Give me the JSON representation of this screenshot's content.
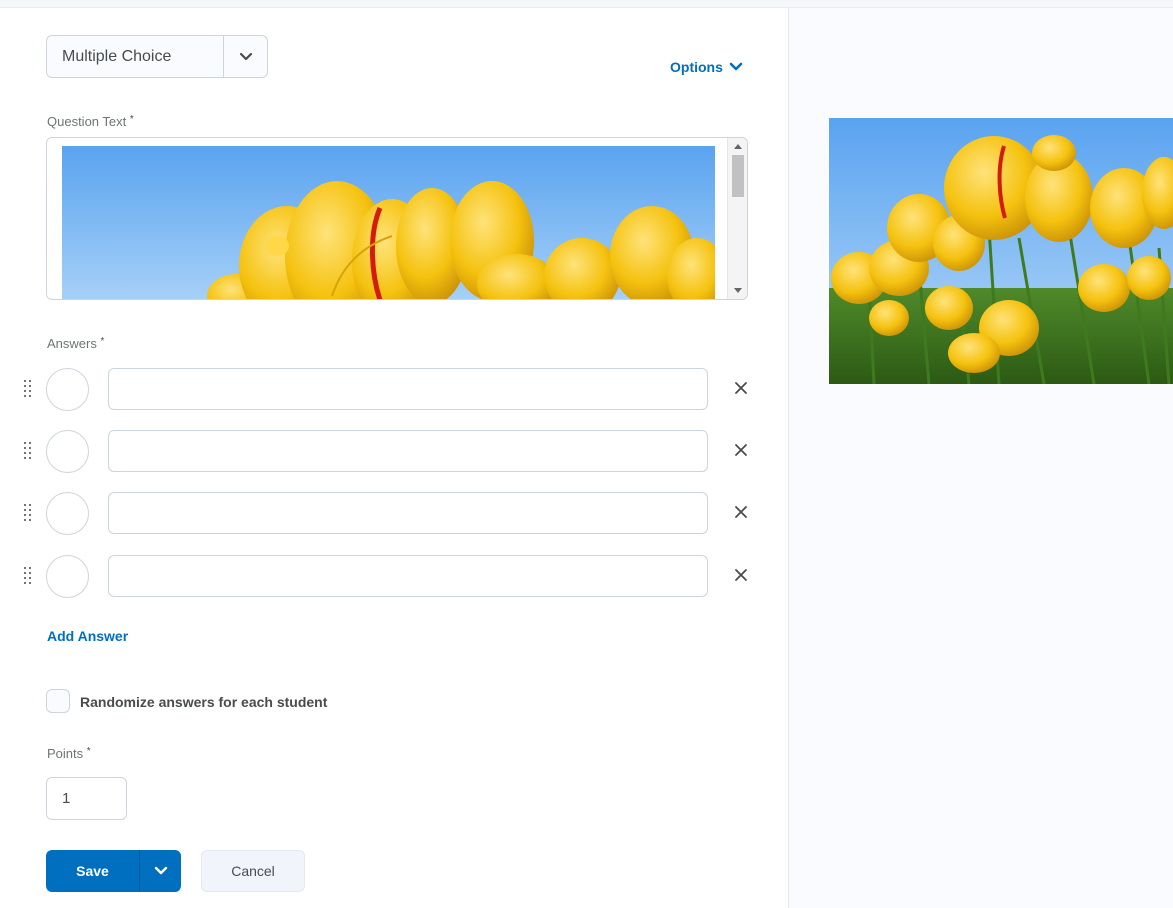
{
  "question_type": {
    "selected": "Multiple Choice",
    "icon": "chevron-down-icon"
  },
  "options_link": {
    "label": "Options",
    "icon": "chevron-down-icon"
  },
  "question_text": {
    "label": "Question Text",
    "required_marker": "*",
    "image": "yellow-tulips-image"
  },
  "answers": {
    "label": "Answers",
    "required_marker": "*",
    "items": [
      {
        "value": ""
      },
      {
        "value": ""
      },
      {
        "value": ""
      },
      {
        "value": ""
      }
    ],
    "add_label": "Add Answer",
    "remove_icon": "close-icon",
    "drag_icon": "drag-handle-icon"
  },
  "randomize": {
    "label": "Randomize answers for each student",
    "checked": false
  },
  "points": {
    "label": "Points",
    "required_marker": "*",
    "value": "1"
  },
  "actions": {
    "save_label": "Save",
    "cancel_label": "Cancel"
  },
  "preview": {
    "image": "yellow-tulips-image"
  },
  "colors": {
    "accent": "#006fbf",
    "text": "#494c4e",
    "border": "#cdd5dc",
    "sky": "#7ab8f5",
    "tulip": "#f5c518",
    "stem": "#3f7a1f"
  }
}
